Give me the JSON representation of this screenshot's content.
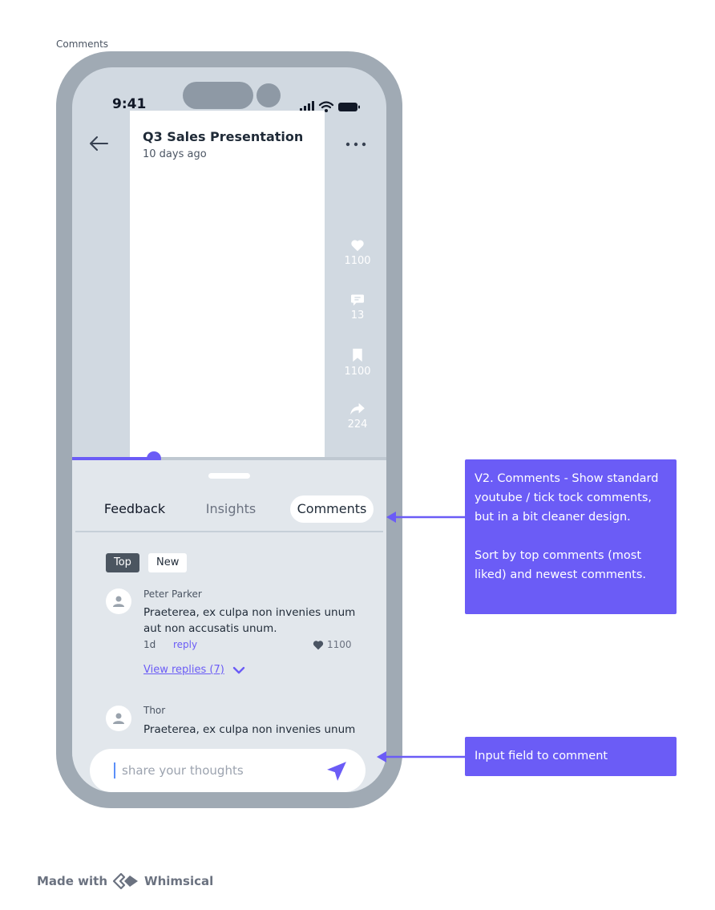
{
  "frame_label": "Comments",
  "status_bar": {
    "time": "9:41"
  },
  "video": {
    "title": "Q3 Sales Presentation",
    "subtitle": "10 days ago"
  },
  "actions": [
    {
      "icon": "heart-icon",
      "count": "1100"
    },
    {
      "icon": "comment-icon",
      "count": "13"
    },
    {
      "icon": "bookmark-icon",
      "count": "1100"
    },
    {
      "icon": "share-icon",
      "count": "224"
    }
  ],
  "progress": {
    "fraction": 0.26,
    "accent": "#6b5cf6"
  },
  "tabs": [
    {
      "label": "Feedback"
    },
    {
      "label": "Insights"
    },
    {
      "label": "Comments",
      "selected": true
    }
  ],
  "sort": {
    "top": "Top",
    "new": "New",
    "selected": "Top"
  },
  "comments": [
    {
      "author": "Peter Parker",
      "text": "Praeterea, ex culpa non invenies unum aut non accusatis unum.",
      "age": "1d",
      "reply_label": "reply",
      "likes": "1100",
      "view_replies": "View replies (7)"
    },
    {
      "author": "Thor",
      "text": "Praeterea, ex culpa non invenies unum"
    }
  ],
  "input": {
    "placeholder": "share your thoughts"
  },
  "annotations": {
    "comments_note": "V2. Comments - Show standard youtube / tick tock comments, but in a bit cleaner design.\n\nSort by top comments (most liked) and newest comments.",
    "input_note": "Input field to comment"
  },
  "footer": {
    "made_with": "Made with",
    "brand": "Whimsical"
  },
  "colors": {
    "accent": "#6b5cf6",
    "phone_frame": "#a0aab4",
    "screen_bg": "#d1d9e1",
    "sheet_bg": "#e2e7ec"
  }
}
